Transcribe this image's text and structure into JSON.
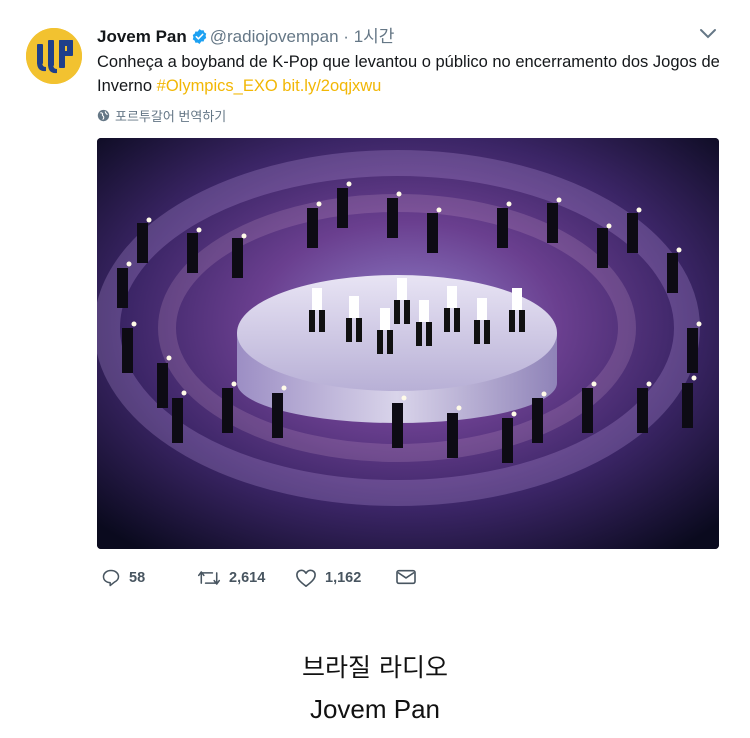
{
  "tweet": {
    "author_name": "Jovem Pan",
    "handle": "@radiojovempan",
    "separator": "·",
    "time": "1시간",
    "text": "Conheça a boyband de K-Pop que levantou o público no encerramento dos Jogos de Inverno",
    "hashtag": "#Olympics_EXO",
    "link": "bit.ly/2oqjxwu",
    "translate_label": "포르투갈어 번역하기",
    "reply_count": "58",
    "retweet_count": "2,614",
    "like_count": "1,162",
    "icons": [
      "verified-badge-icon",
      "chevron-down-icon",
      "globe-icon",
      "reply-icon",
      "retweet-icon",
      "like-icon",
      "message-icon"
    ]
  },
  "caption": {
    "line1": "브라질 라디오",
    "line2": "Jovem Pan"
  },
  "colors": {
    "link": "#f2b705",
    "verified": "#1da1f2",
    "avatar": "#f2c230",
    "muted": "#657786"
  }
}
